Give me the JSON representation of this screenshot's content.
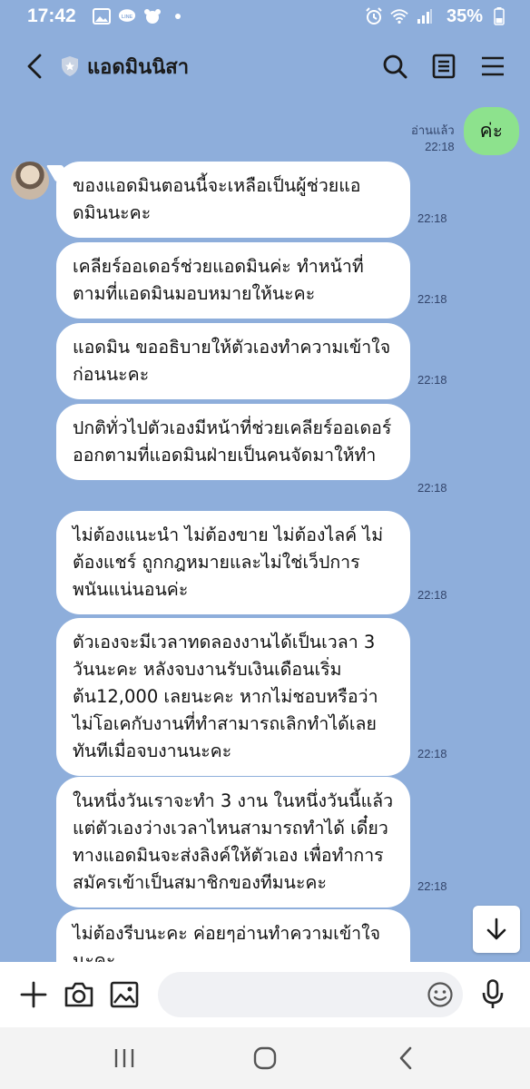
{
  "status_bar": {
    "time": "17:42",
    "battery": "35%",
    "left_icons": [
      "image-icon",
      "line-icon",
      "pet-icon",
      "dot-icon"
    ],
    "right_icons": [
      "alarm-icon",
      "wifi-icon",
      "signal-icon",
      "battery-icon"
    ]
  },
  "header": {
    "title": "แอดมินนิสา",
    "icons": [
      "back-icon",
      "shield-icon",
      "search-icon",
      "notes-icon",
      "menu-icon"
    ]
  },
  "sent_message": {
    "read_label": "อ่านแล้ว",
    "time": "22:18",
    "text": "ค่ะ"
  },
  "messages": [
    {
      "text": "ของแอดมินตอนนี้จะเหลือเป็นผู้ช่วยแอดมินนะคะ",
      "time": "22:18"
    },
    {
      "text": "เคลียร์ออเดอร์ช่วยแอดมินค่ะ ทำหน้าที่ตามที่แอดมินมอบหมายให้นะคะ",
      "time": "22:18"
    },
    {
      "text": "แอดมิน ขออธิบายให้ตัวเองทำความเข้าใจก่อนนะคะ",
      "time": "22:18"
    },
    {
      "text": "ปกติทั่วไปตัวเองมีหน้าที่ช่วยเคลียร์ออเดอร์ออกตามที่แอดมินฝ่ายเป็นคนจัดมาให้ทำ",
      "time": "22:18"
    },
    {
      "text": "ไม่ต้องแนะนำ ไม่ต้องขาย ไม่ต้องไลค์ ไม่ต้องแชร์ ถูกกฎหมายและไม่ใช่เว็ปการพนันแน่นอนค่ะ",
      "time": "22:18"
    },
    {
      "text": "ตัวเองจะมีเวลาทดลองงานได้เป็นเวลา 3 วันนะคะ หลังจบงานรับเงินเดือนเริ่มต้น12,000 เลยนะคะ หากไม่ชอบหรือว่าไม่โอเคกับงานที่ทำสามารถเลิกทำได้เลยทันทีเมื่อจบงานนะคะ",
      "time": "22:18"
    },
    {
      "text": "ในหนึ่งวันเราจะทำ 3 งาน ในหนึ่งวันนี้แล้วแต่ตัวเองว่างเวลาไหนสามารถทำได้ เดี๋ยวทางแอดมินจะส่งลิงค์ให้ตัวเอง เพื่อทำการสมัครเข้าเป็นสมาชิกของทีมนะคะ",
      "time": "22:18"
    },
    {
      "text": "ไม่ต้องรีบนะคะ ค่อยๆอ่านทำความเข้าใจนะคะ",
      "time": ""
    }
  ],
  "input_bar": {
    "icons": [
      "plus-icon",
      "camera-icon",
      "gallery-icon",
      "emoji-icon",
      "mic-icon"
    ],
    "placeholder": ""
  },
  "nav_bar": {
    "icons": [
      "recents-icon",
      "home-icon",
      "back-nav-icon"
    ]
  },
  "colors": {
    "background": "#8eaedb",
    "sent_bubble": "#8de28d",
    "received_bubble": "#ffffff"
  }
}
